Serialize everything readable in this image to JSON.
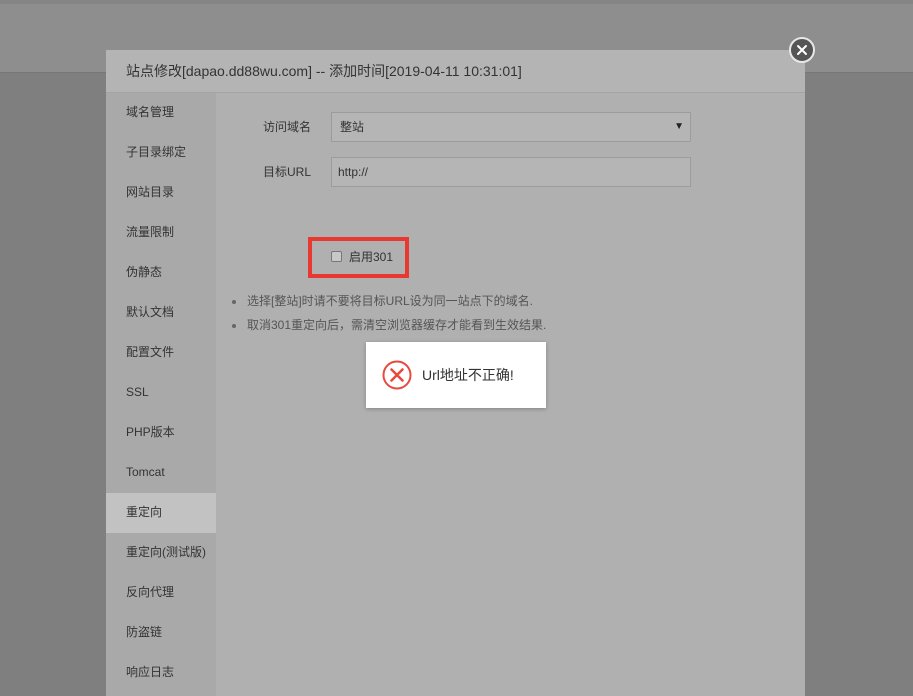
{
  "modal": {
    "title": "站点修改[dapao.dd88wu.com] -- 添加时间[2019-04-11 10:31:01]"
  },
  "sidebar": {
    "items": [
      {
        "label": "域名管理"
      },
      {
        "label": "子目录绑定"
      },
      {
        "label": "网站目录"
      },
      {
        "label": "流量限制"
      },
      {
        "label": "伪静态"
      },
      {
        "label": "默认文档"
      },
      {
        "label": "配置文件"
      },
      {
        "label": "SSL"
      },
      {
        "label": "PHP版本"
      },
      {
        "label": "Tomcat"
      },
      {
        "label": "重定向"
      },
      {
        "label": "重定向(测试版)"
      },
      {
        "label": "反向代理"
      },
      {
        "label": "防盗链"
      },
      {
        "label": "响应日志"
      }
    ],
    "active": "重定向"
  },
  "form": {
    "domain_label": "访问域名",
    "domain_value": "整站",
    "target_label": "目标URL",
    "target_value": "http://",
    "enable301_label": "启用301",
    "enable301_checked": false
  },
  "notes": [
    "选择[整站]时请不要将目标URL设为同一站点下的域名.",
    "取消301重定向后，需清空浏览器缓存才能看到生效结果."
  ],
  "toast": {
    "message": "Url地址不正确!",
    "icon": "error-x-icon",
    "color": "#e8493d"
  },
  "colors": {
    "highlight": "#e8382f"
  }
}
